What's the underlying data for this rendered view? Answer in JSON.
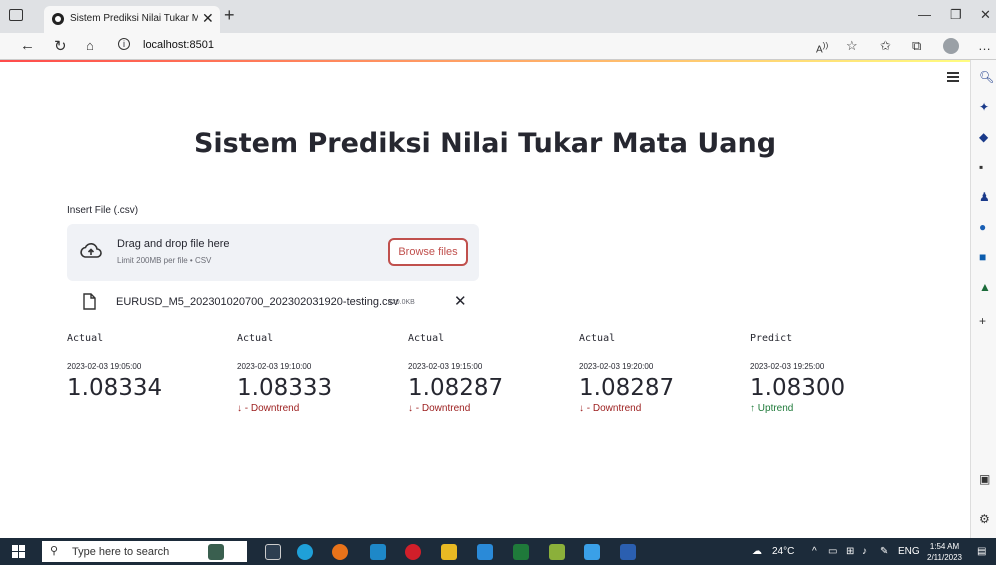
{
  "browser": {
    "tab_title": "Sistem Prediksi Nilai Tukar Mata",
    "url": "localhost:8501"
  },
  "app": {
    "title": "Sistem Prediksi Nilai Tukar Mata Uang",
    "uploader": {
      "label": "Insert File (.csv)",
      "drop_text": "Drag and drop file here",
      "limit_text": "Limit 200MB per file • CSV",
      "button_label": "Browse files"
    },
    "file": {
      "name": "EURUSD_M5_202301020700_202302031920-testing.csv",
      "size": "420.0KB"
    },
    "metrics": [
      {
        "label": "Actual",
        "time": "2023-02-03 19:05:00",
        "value": "1.08334",
        "delta": ""
      },
      {
        "label": "Actual",
        "time": "2023-02-03 19:10:00",
        "value": "1.08333",
        "delta": "- Downtrend",
        "arrow": "↓"
      },
      {
        "label": "Actual",
        "time": "2023-02-03 19:15:00",
        "value": "1.08287",
        "delta": "- Downtrend",
        "arrow": "↓"
      },
      {
        "label": "Actual",
        "time": "2023-02-03 19:20:00",
        "value": "1.08287",
        "delta": "- Downtrend",
        "arrow": "↓"
      },
      {
        "label": "Predict",
        "time": "2023-02-03 19:25:00",
        "value": "1.08300",
        "delta": "Uptrend",
        "arrow": "↑"
      }
    ]
  },
  "taskbar": {
    "search_placeholder": "Type here to search",
    "weather": "24°C",
    "language": "ENG",
    "time": "1:54 AM",
    "date": "2/11/2023"
  },
  "colors": {
    "accent": "#c0504d",
    "downtrend": "#9b1c1c",
    "uptrend": "#1f7a3a"
  }
}
